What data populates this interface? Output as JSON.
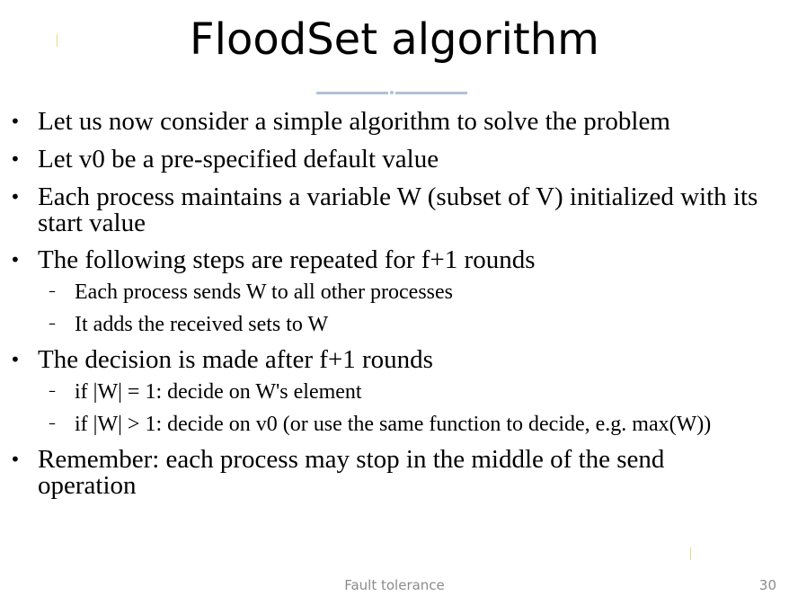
{
  "slide": {
    "title": "FloodSet algorithm",
    "bullets": [
      {
        "text": "Let us now consider a simple algorithm to solve the problem"
      },
      {
        "text": "Let v0 be a  pre-specified default value"
      },
      {
        "text": "Each process maintains a variable W (subset of V) initialized with its start value"
      },
      {
        "text": "The following steps are repeated for f+1 rounds",
        "subitems": [
          "Each process sends W to all other processes",
          "It adds the received sets to W"
        ]
      },
      {
        "text": "The decision is made after f+1 rounds",
        "subitems": [
          "if |W| = 1: decide on W's element",
          "if |W| > 1: decide on v0 (or use the same function to decide, e.g. max(W))"
        ]
      },
      {
        "text": "Remember: each process may stop in the middle of the send operation"
      }
    ],
    "bullet_glyph": "•",
    "dash_glyph": "–"
  },
  "footer": {
    "label": "Fault tolerance",
    "page_number": "30"
  },
  "colors": {
    "divider": "#b3c0d6",
    "footer_text": "#8c8c8c"
  }
}
